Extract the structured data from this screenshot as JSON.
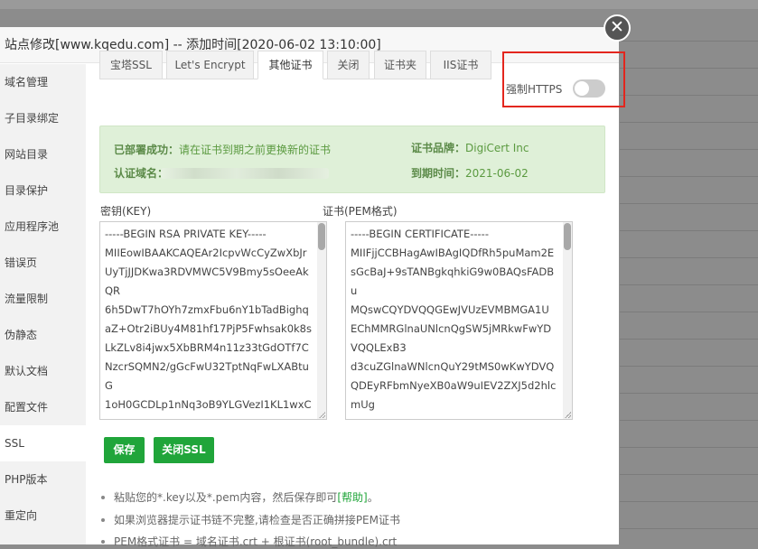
{
  "dialog": {
    "title": "站点修改[www.kqedu.com] -- 添加时间[2020-06-02 13:10:00]",
    "close_glyph": "✕"
  },
  "sidebar": {
    "items": [
      {
        "label": "域名管理"
      },
      {
        "label": "子目录绑定"
      },
      {
        "label": "网站目录"
      },
      {
        "label": "目录保护"
      },
      {
        "label": "应用程序池"
      },
      {
        "label": "错误页"
      },
      {
        "label": "流量限制"
      },
      {
        "label": "伪静态"
      },
      {
        "label": "默认文档"
      },
      {
        "label": "配置文件"
      },
      {
        "label": "SSL",
        "active": true
      },
      {
        "label": "PHP版本"
      },
      {
        "label": "重定向"
      }
    ]
  },
  "tabs": [
    {
      "label": "宝塔SSL"
    },
    {
      "label": "Let's Encrypt"
    },
    {
      "label": "其他证书",
      "active": true
    },
    {
      "label": "关闭"
    },
    {
      "label": "证书夹"
    },
    {
      "label": "IIS证书"
    }
  ],
  "force_https": {
    "label": "强制HTTPS",
    "enabled": false
  },
  "status": {
    "deployed_label": "已部署成功：",
    "deployed_text": "请在证书到期之前更换新的证书",
    "domain_label": "认证域名：",
    "brand_label": "证书品牌：",
    "brand_value": "DigiCert Inc",
    "expiry_label": "到期时间：",
    "expiry_value": "2021-06-02"
  },
  "key_field": {
    "label": "密钥(KEY)",
    "lines": [
      "-----BEGIN RSA PRIVATE KEY-----",
      "MIIEowIBAAKCAQEAr2IcpvWcCyZwXbJr",
      "UyTjJJDKwa3RDVMWC5V9Bmy5sOeeAk",
      "QR",
      "6h5DwT7hOYh7zmxFbu6nY1bTadBighq",
      "aZ+Otr2iBUy4M81hf17PjP5Fwhsak0k8s",
      "LkZLv8i4jwx5XbBRM4n11z33tGdOTf7C",
      "NzcrSQMN2/gGcFwU32TptNqFwLXABtu",
      "G",
      "1oH0GCDLp1nNq3oB9YLGVezI1KL1wxC"
    ]
  },
  "cert_field": {
    "label": "证书(PEM格式)",
    "lines": [
      "-----BEGIN CERTIFICATE-----",
      "MIIFjjCCBHagAwIBAgIQDfRh5puMam2E",
      "sGcBaJ+9sTANBgkqhkiG9w0BAQsFADB",
      "u",
      "MQswCQYDVQQGEwJVUzEVMBMGA1U",
      "EChMMRGlnaUNlcnQgSW5jMRkwFwYD",
      "VQQLExB3",
      "d3cuZGlnaWNlcnQuY29tMS0wKwYDVQ",
      "QDEyRFbmNyeXB0aW9uIEV2ZXJ5d2hlc",
      "mUg"
    ]
  },
  "buttons": {
    "save": "保存",
    "close_ssl": "关闭SSL"
  },
  "tips": [
    {
      "text": "粘贴您的*.key以及*.pem内容，然后保存即可",
      "link": "[帮助]",
      "suffix": "。"
    },
    {
      "text": "如果浏览器提示证书链不完整,请检查是否正确拼接PEM证书",
      "link": "",
      "suffix": ""
    },
    {
      "text": "PEM格式证书 = 域名证书.crt + 根证书(root_bundle).crt",
      "link": "",
      "suffix": ""
    }
  ],
  "colors": {
    "accent": "#20a53a",
    "highlight_border": "#e3261e",
    "notice_bg": "#dff0d8"
  }
}
